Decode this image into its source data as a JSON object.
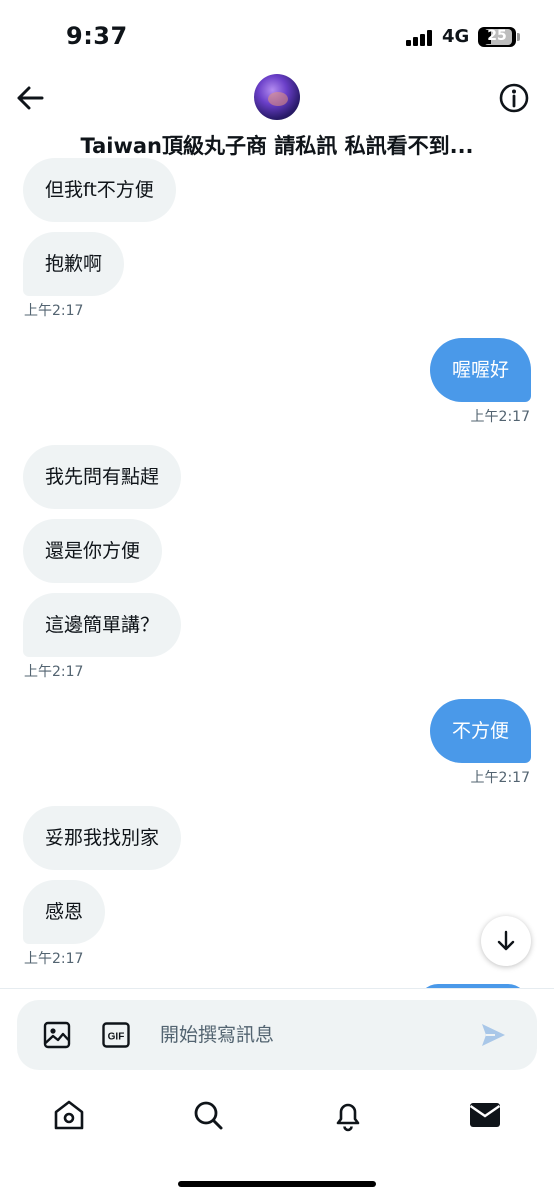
{
  "status_bar": {
    "time": "9:37",
    "network": "4G",
    "battery": "25"
  },
  "header": {
    "title": "Taiwan頂級丸子商 請私訊 私訊看不到...",
    "back_icon": "arrow-left-icon",
    "info_icon": "info-circle-icon"
  },
  "messages": [
    {
      "side": "in",
      "text": "但我ft不方便"
    },
    {
      "side": "in",
      "text": "抱歉啊"
    },
    {
      "side": "in_ts",
      "text": "上午2:17"
    },
    {
      "side": "out",
      "text": "喔喔好"
    },
    {
      "side": "out_ts",
      "text": "上午2:17"
    },
    {
      "side": "in",
      "text": "我先問有點趕"
    },
    {
      "side": "in",
      "text": "還是你方便"
    },
    {
      "side": "in",
      "text": "這邊簡單講？"
    },
    {
      "side": "in_ts",
      "text": "上午2:17"
    },
    {
      "side": "out",
      "text": "不方便"
    },
    {
      "side": "out_ts",
      "text": "上午2:17"
    },
    {
      "side": "in",
      "text": "妥那我找別家"
    },
    {
      "side": "in",
      "text": "感恩"
    },
    {
      "side": "in_ts",
      "text": "上午2:17"
    }
  ],
  "composer": {
    "placeholder": "開始撰寫訊息",
    "gif_label": "GIF"
  },
  "tabs": [
    "home",
    "search",
    "notifications",
    "messages"
  ],
  "colors": {
    "accent": "#4a99e9",
    "incoming_bubble": "#eff3f4",
    "timestamp": "#536471"
  }
}
